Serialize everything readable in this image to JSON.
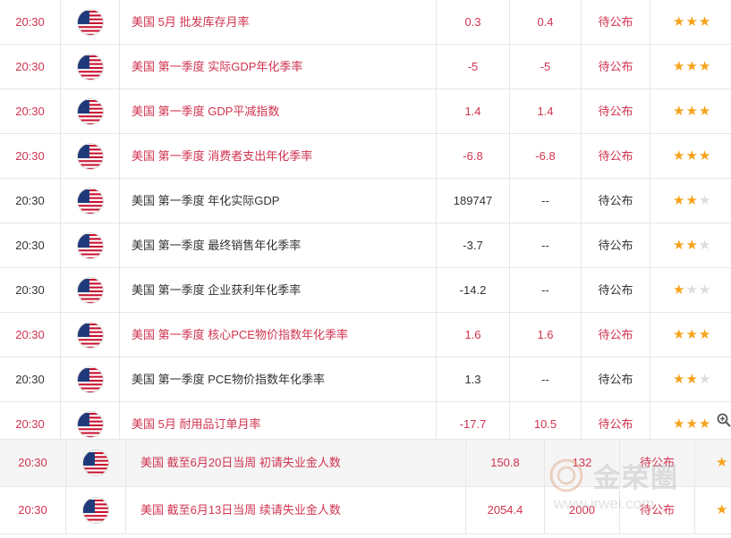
{
  "rows": [
    {
      "time": "20:30",
      "name": "美国 5月 批发库存月率",
      "previous": "0.3",
      "forecast": "0.4",
      "actual": "待公布",
      "stars": 3,
      "highlight": true
    },
    {
      "time": "20:30",
      "name": "美国 第一季度 实际GDP年化季率",
      "previous": "-5",
      "forecast": "-5",
      "actual": "待公布",
      "stars": 3,
      "highlight": true
    },
    {
      "time": "20:30",
      "name": "美国 第一季度 GDP平减指数",
      "previous": "1.4",
      "forecast": "1.4",
      "actual": "待公布",
      "stars": 3,
      "highlight": true
    },
    {
      "time": "20:30",
      "name": "美国 第一季度 消费者支出年化季率",
      "previous": "-6.8",
      "forecast": "-6.8",
      "actual": "待公布",
      "stars": 3,
      "highlight": true
    },
    {
      "time": "20:30",
      "name": "美国 第一季度 年化实际GDP",
      "previous": "189747",
      "forecast": "--",
      "actual": "待公布",
      "stars": 2,
      "highlight": false
    },
    {
      "time": "20:30",
      "name": "美国 第一季度 最终销售年化季率",
      "previous": "-3.7",
      "forecast": "--",
      "actual": "待公布",
      "stars": 2,
      "highlight": false
    },
    {
      "time": "20:30",
      "name": "美国 第一季度 企业获利年化季率",
      "previous": "-14.2",
      "forecast": "--",
      "actual": "待公布",
      "stars": 1,
      "highlight": false
    },
    {
      "time": "20:30",
      "name": "美国 第一季度 核心PCE物价指数年化季率",
      "previous": "1.6",
      "forecast": "1.6",
      "actual": "待公布",
      "stars": 3,
      "highlight": true
    },
    {
      "time": "20:30",
      "name": "美国 第一季度 PCE物价指数年化季率",
      "previous": "1.3",
      "forecast": "--",
      "actual": "待公布",
      "stars": 2,
      "highlight": false
    },
    {
      "time": "20:30",
      "name": "美国 5月 耐用品订单月率",
      "previous": "-17.7",
      "forecast": "10.5",
      "actual": "待公布",
      "stars": 3,
      "highlight": true
    }
  ],
  "rows2": [
    {
      "time": "20:30",
      "name": "美国 截至6月20日当周 初请失业金人数",
      "previous": "150.8",
      "forecast": "132",
      "actual": "待公布",
      "stars": 1
    },
    {
      "time": "20:30",
      "name": "美国 截至6月13日当周 续请失业金人数",
      "previous": "2054.4",
      "forecast": "2000",
      "actual": "待公布",
      "stars": 1
    }
  ],
  "watermark": {
    "brand": "金荣圈",
    "url": "www.jrwei.com"
  },
  "icons": {
    "flag": "us-flag-icon",
    "star": "star-icon",
    "zoom": "zoom-in-icon"
  },
  "colors": {
    "highlight": "#d0334f",
    "plain": "#333333",
    "star_on": "#f7a21b",
    "star_off": "#dcdcdc"
  }
}
